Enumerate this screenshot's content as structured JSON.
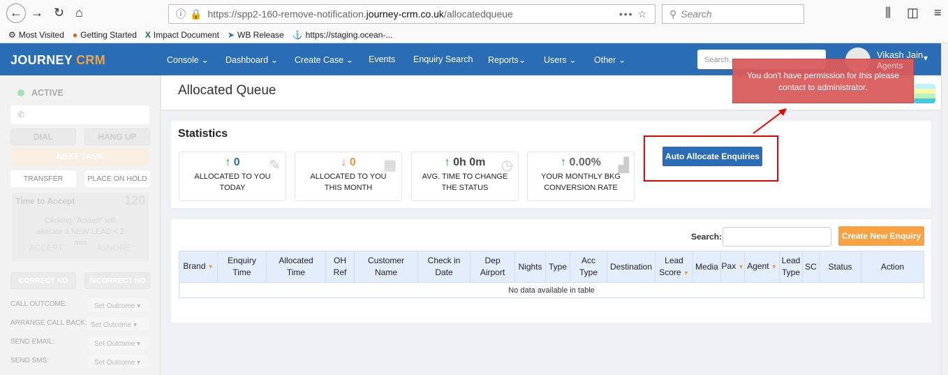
{
  "browser": {
    "url_prefix": "https://spp2-160-remove-notification.",
    "url_domain": "journey-crm.co.uk",
    "url_path": "/allocatedqueue",
    "search_placeholder": "Search",
    "bookmarks": [
      "Most Visited",
      "Getting Started",
      "Impact Document",
      "WB Release",
      "https://staging.ocean-..."
    ]
  },
  "nav": {
    "logo_a": "JOURNEY",
    "logo_b": " CRM",
    "items": [
      "Console",
      "Dashboard",
      "Create Case",
      "Events",
      "Enquiry Search",
      "Reports",
      "Users",
      "Other"
    ],
    "search_placeholder": "Search...",
    "user_name": "Vikash Jain",
    "user_role": "Agents"
  },
  "sidebar": {
    "status": "ACTIVE",
    "dial": "DIAL",
    "hangup": "HANG UP",
    "next_task": "NEXT TASK",
    "transfer": "TRANSFER",
    "hold": "PLACE ON HOLD",
    "time_to_accept": "Time to Accept",
    "timer": "120",
    "accept_note": "Clicking \"Accept\" will allocate a NEW LEAD < 2 min",
    "accept": "ACCEPT",
    "ignore": "IGNORE",
    "correct": "CORRECT NO",
    "incorrect": "INCORRECT NO",
    "outcomes": [
      {
        "label": "CALL OUTCOME:",
        "value": "Set Outcome"
      },
      {
        "label": "ARRANGE CALL BACK:",
        "value": "Set Outcome"
      },
      {
        "label": "SEND EMAIL:",
        "value": "Set Outcome"
      },
      {
        "label": "SEND SMS:",
        "value": "Set Outcome"
      }
    ]
  },
  "page": {
    "title": "Allocated Queue"
  },
  "toast": {
    "message": "You don't have permission for this please contact to administrator."
  },
  "stats": {
    "heading": "Statistics",
    "auto_allocate": "Auto Allocate Enquiries",
    "cards": [
      {
        "value": "0",
        "arrow": "↑",
        "arrow_color": "#1e9b3c",
        "value_color": "#2a6db5",
        "l1": "ALLOCATED TO YOU",
        "l2": "TODAY",
        "icon": "✎"
      },
      {
        "value": "0",
        "arrow": "↓",
        "arrow_color": "#f07f7f",
        "value_color": "#f0932b",
        "l1": "ALLOCATED TO YOU",
        "l2": "THIS MONTH",
        "icon": "▦"
      },
      {
        "value": "0h 0m",
        "arrow": "↑",
        "arrow_color": "#1e9b3c",
        "value_color": "#444",
        "l1": "AVG. TIME TO CHANGE",
        "l2": "THE STATUS",
        "icon": "◷"
      },
      {
        "value": "0.00%",
        "arrow": "↑",
        "arrow_color": "#1e9b3c",
        "value_color": "#666",
        "l1": "YOUR MONTHLY BKG",
        "l2": "CONVERSION RATE",
        "icon": "▟"
      }
    ]
  },
  "table": {
    "search_label": "Search:",
    "create_button": "Create New Enquiry",
    "empty": "No data available in table",
    "columns": [
      [
        "Brand",
        ""
      ],
      [
        "Enquiry",
        "Time"
      ],
      [
        "Allocated",
        "Time"
      ],
      [
        "OH",
        "Ref"
      ],
      [
        "Customer",
        "Name"
      ],
      [
        "Check in",
        "Date"
      ],
      [
        "Dep",
        "Airport"
      ],
      [
        "Nights",
        ""
      ],
      [
        "Type",
        ""
      ],
      [
        "Acc",
        "Type"
      ],
      [
        "Destination",
        ""
      ],
      [
        "Lead",
        "Score"
      ],
      [
        "Media",
        ""
      ],
      [
        "Pax",
        ""
      ],
      [
        "Agent",
        ""
      ],
      [
        "Lead",
        "Type"
      ],
      [
        "SC",
        ""
      ],
      [
        "Status",
        ""
      ],
      [
        "Action",
        ""
      ]
    ]
  }
}
